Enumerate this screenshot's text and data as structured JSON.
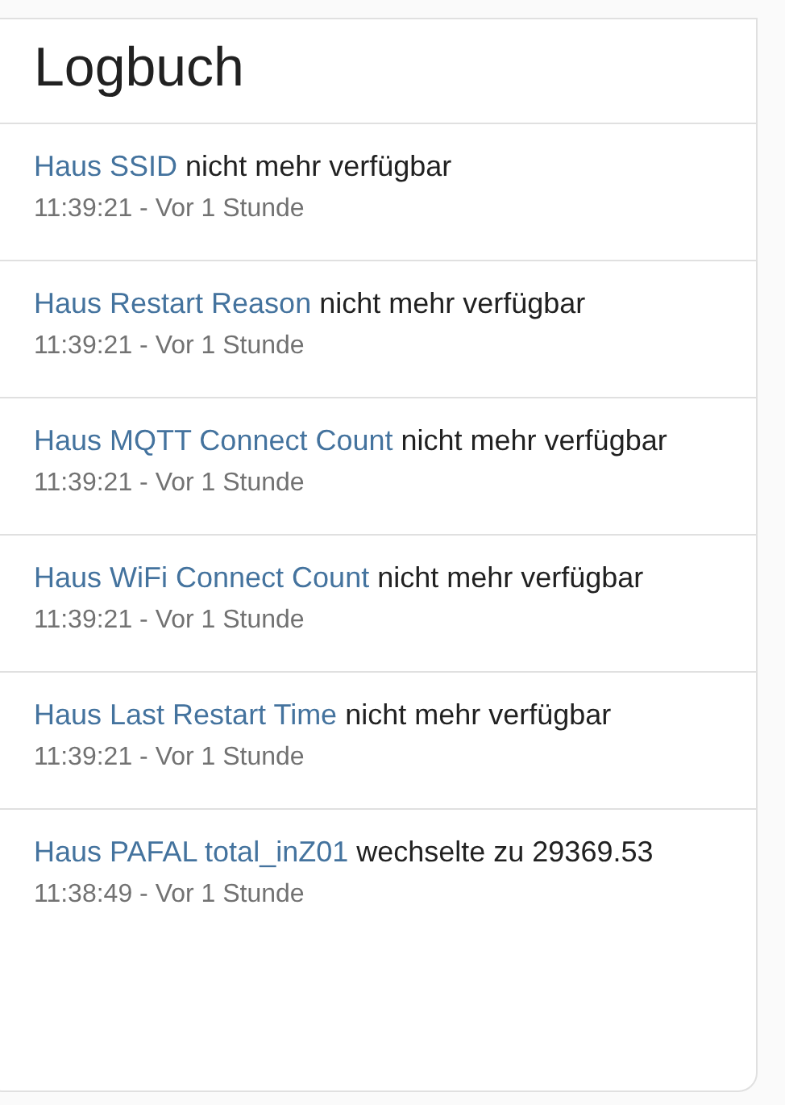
{
  "card": {
    "title": "Logbuch",
    "entries": [
      {
        "entity": "Haus SSID",
        "message": "nicht mehr verfügbar",
        "time": "11:39:21 - Vor 1 Stunde"
      },
      {
        "entity": "Haus Restart Reason",
        "message": "nicht mehr verfügbar",
        "time": "11:39:21 - Vor 1 Stunde"
      },
      {
        "entity": "Haus MQTT Connect Count",
        "message": "nicht mehr verfügbar",
        "time": "11:39:21 - Vor 1 Stunde"
      },
      {
        "entity": "Haus WiFi Connect Count",
        "message": "nicht mehr verfügbar",
        "time": "11:39:21 - Vor 1 Stunde"
      },
      {
        "entity": "Haus Last Restart Time",
        "message": "nicht mehr verfügbar",
        "time": "11:39:21 - Vor 1 Stunde"
      },
      {
        "entity": "Haus PAFAL total_inZ01",
        "message": "wechselte zu 29369.53",
        "time": "11:38:49 - Vor 1 Stunde"
      }
    ]
  }
}
